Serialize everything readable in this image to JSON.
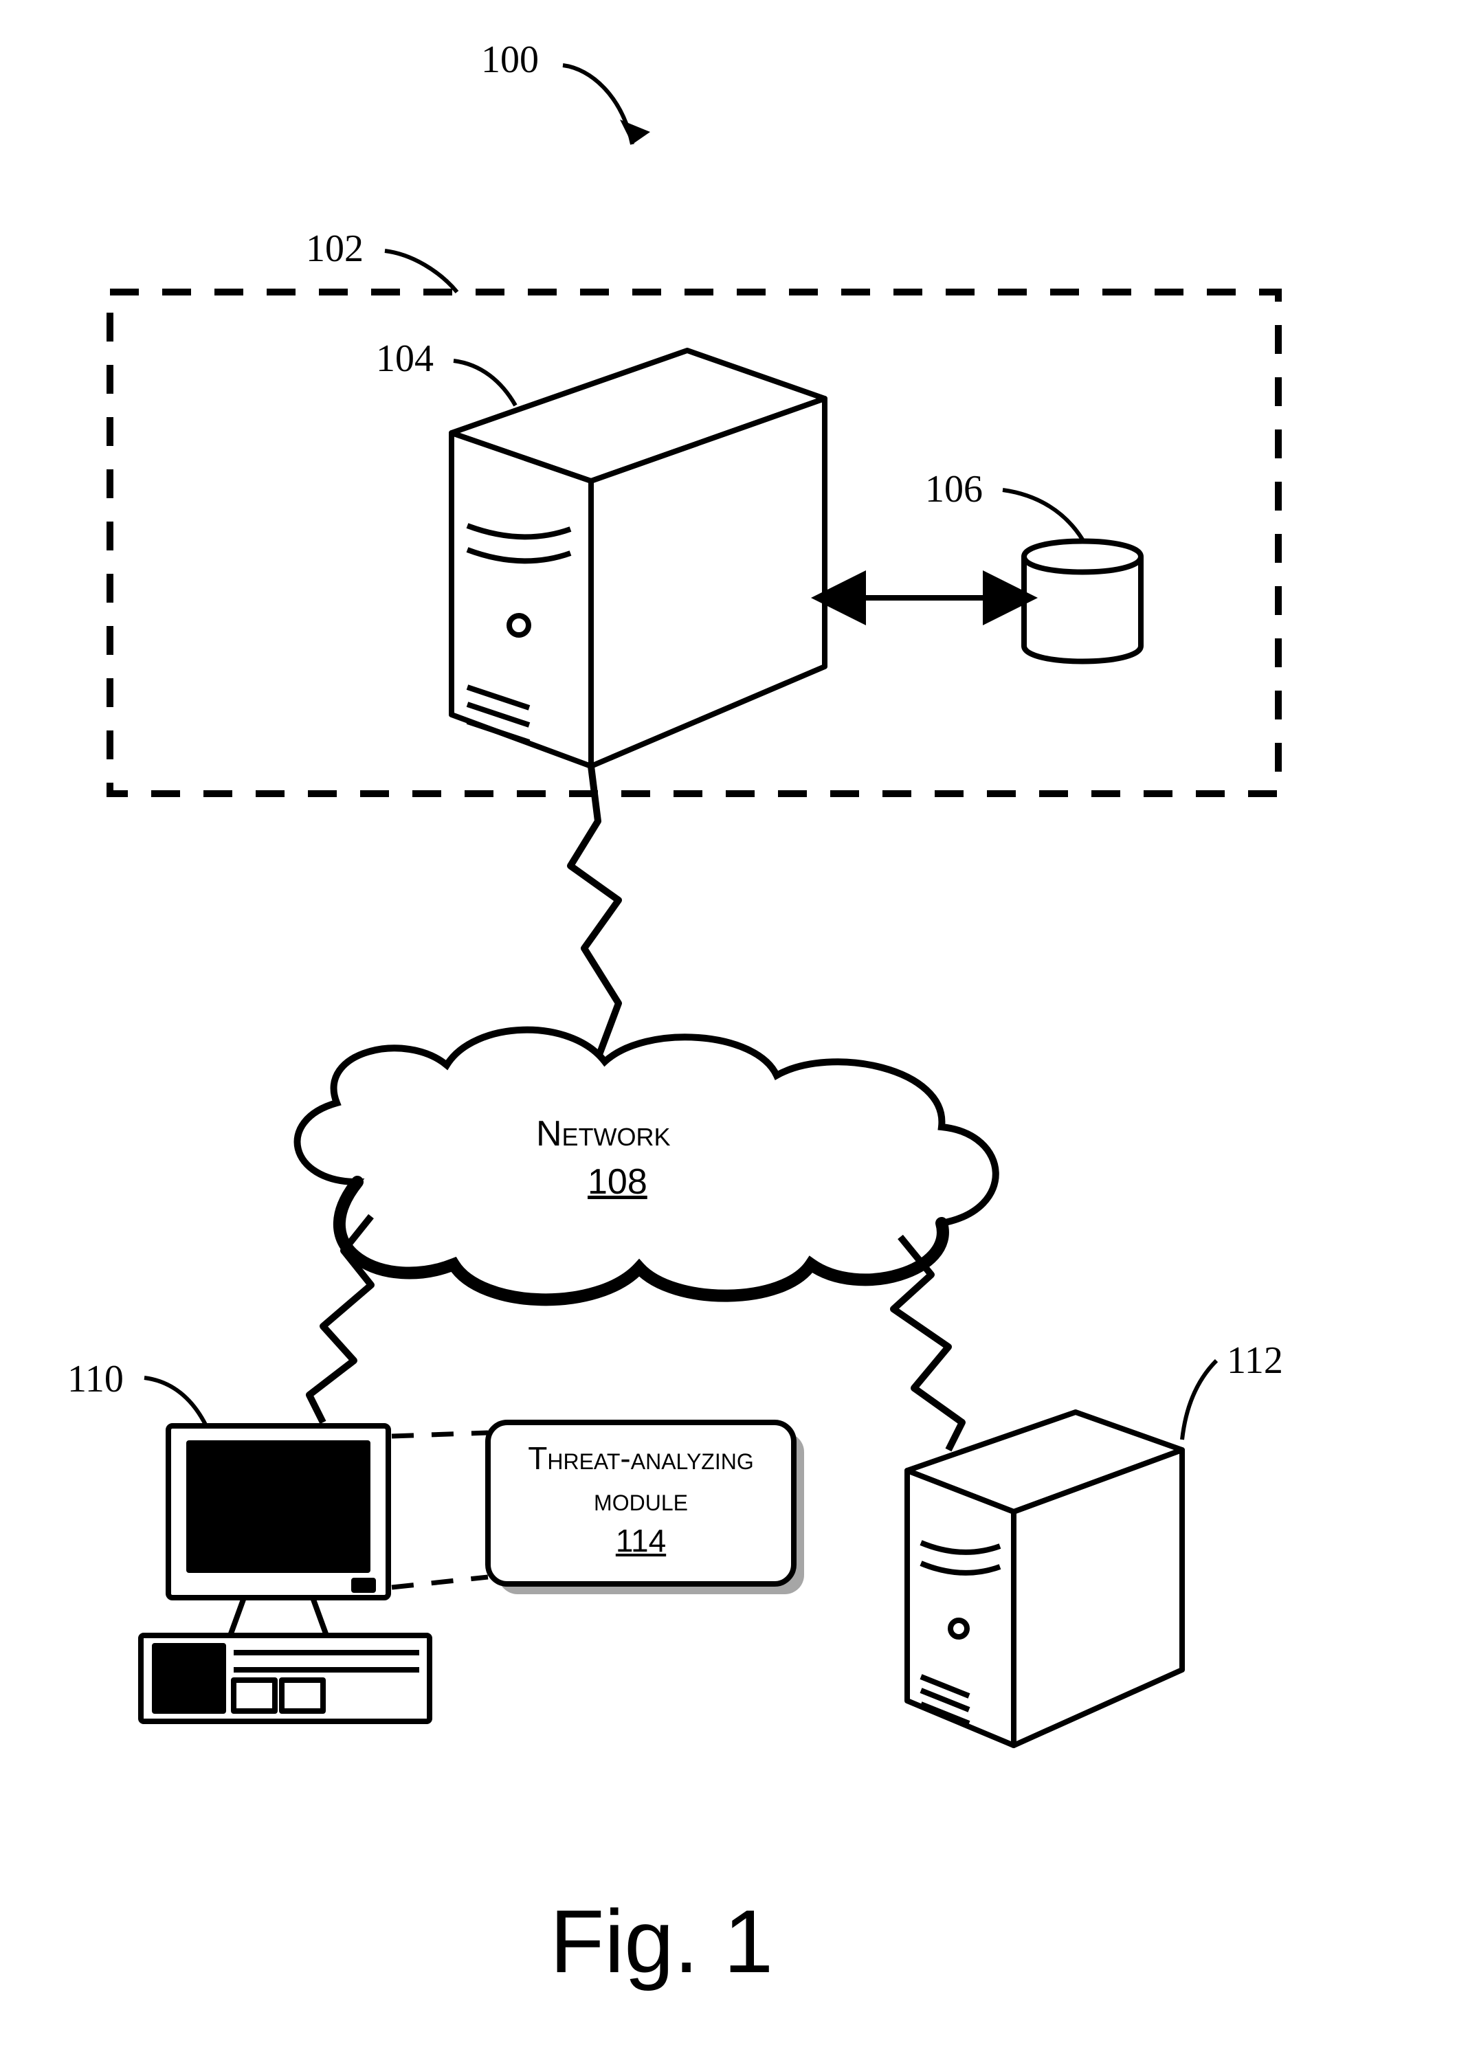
{
  "labels": {
    "system_ref": "100",
    "group_ref": "102",
    "server_ref": "104",
    "db_ref": "106",
    "network_label": "Network",
    "network_ref": "108",
    "client_ref": "110",
    "server2_ref": "112",
    "module_label_line1": "Threat-analyzing",
    "module_label_line2": "module",
    "module_ref": "114"
  },
  "caption": "Fig. 1"
}
